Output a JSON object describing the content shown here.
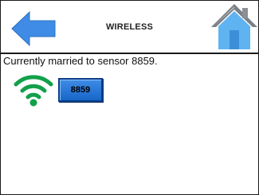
{
  "header": {
    "title": "WIRELESS",
    "back_icon": "back-arrow-icon",
    "home_icon": "home-icon"
  },
  "status": {
    "message": "Currently married to sensor 8859."
  },
  "sensor": {
    "icon": "wifi-signal-icon",
    "id_label": "8859"
  },
  "colors": {
    "accent_blue": "#3f8ce6",
    "wifi_green": "#12a04a",
    "home_roof": "#9aa0a6"
  }
}
